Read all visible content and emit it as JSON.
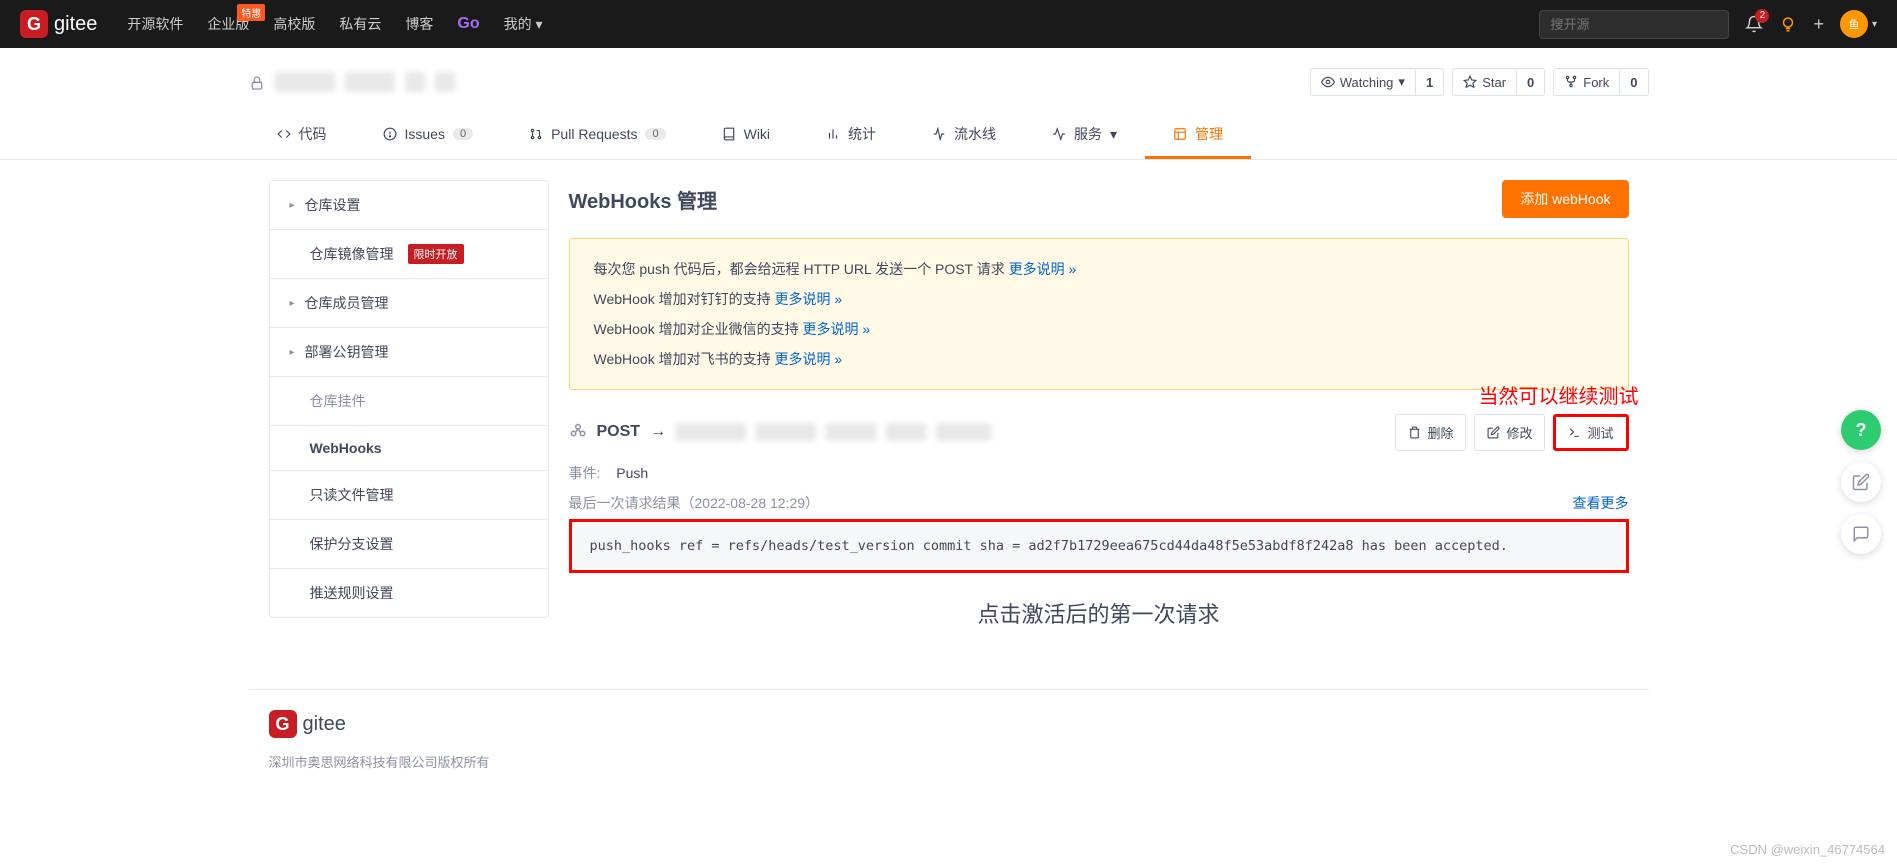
{
  "nav": {
    "logo_text": "gitee",
    "items": [
      "开源软件",
      "企业版",
      "高校版",
      "私有云",
      "博客",
      "Go",
      "我的"
    ],
    "enterprise_badge": "特惠",
    "search_placeholder": "搜开源",
    "notify_count": "2",
    "avatar_text": "鱼"
  },
  "repo": {
    "actions": {
      "watch_label": "Watching",
      "watch_count": "1",
      "star_label": "Star",
      "star_count": "0",
      "fork_label": "Fork",
      "fork_count": "0"
    },
    "tabs": {
      "code": "代码",
      "issues": "Issues",
      "issues_count": "0",
      "pr": "Pull Requests",
      "pr_count": "0",
      "wiki": "Wiki",
      "stats": "统计",
      "pipeline": "流水线",
      "service": "服务",
      "manage": "管理"
    }
  },
  "sidebar": {
    "items": [
      {
        "label": "仓库设置",
        "caret": true
      },
      {
        "label": "仓库镜像管理",
        "badge": "限时开放"
      },
      {
        "label": "仓库成员管理",
        "caret": true
      },
      {
        "label": "部署公钥管理",
        "caret": true
      },
      {
        "label": "仓库挂件",
        "disabled": true
      },
      {
        "label": "WebHooks",
        "active": true
      },
      {
        "label": "只读文件管理"
      },
      {
        "label": "保护分支设置"
      },
      {
        "label": "推送规则设置"
      }
    ]
  },
  "content": {
    "title": "WebHooks 管理",
    "add_btn": "添加 webHook",
    "notices": [
      {
        "text": "每次您 push 代码后，都会给远程 HTTP URL 发送一个 POST 请求 ",
        "link": "更多说明 »"
      },
      {
        "text": "WebHook 增加对钉钉的支持 ",
        "link": "更多说明 »"
      },
      {
        "text": "WebHook 增加对企业微信的支持 ",
        "link": "更多说明 »"
      },
      {
        "text": "WebHook 增加对飞书的支持 ",
        "link": "更多说明 »"
      }
    ],
    "webhook": {
      "method": "POST",
      "arrow": "→",
      "delete_btn": "删除",
      "edit_btn": "修改",
      "test_btn": "测试",
      "event_label": "事件:",
      "event_value": "Push",
      "result_label": "最后一次请求结果（2022-08-28 12:29）",
      "view_more": "查看更多",
      "result_text": "push_hooks ref = refs/heads/test_version commit sha = ad2f7b1729eea675cd44da48f5e53abdf8f242a8 has been accepted."
    }
  },
  "annotations": {
    "test_note": "当然可以继续测试",
    "request_note": "点击激活后的第一次请求"
  },
  "footer": {
    "logo_text": "gitee",
    "copyright": "深圳市奥思网络科技有限公司版权所有"
  },
  "watermark": "CSDN @weixin_46774564"
}
